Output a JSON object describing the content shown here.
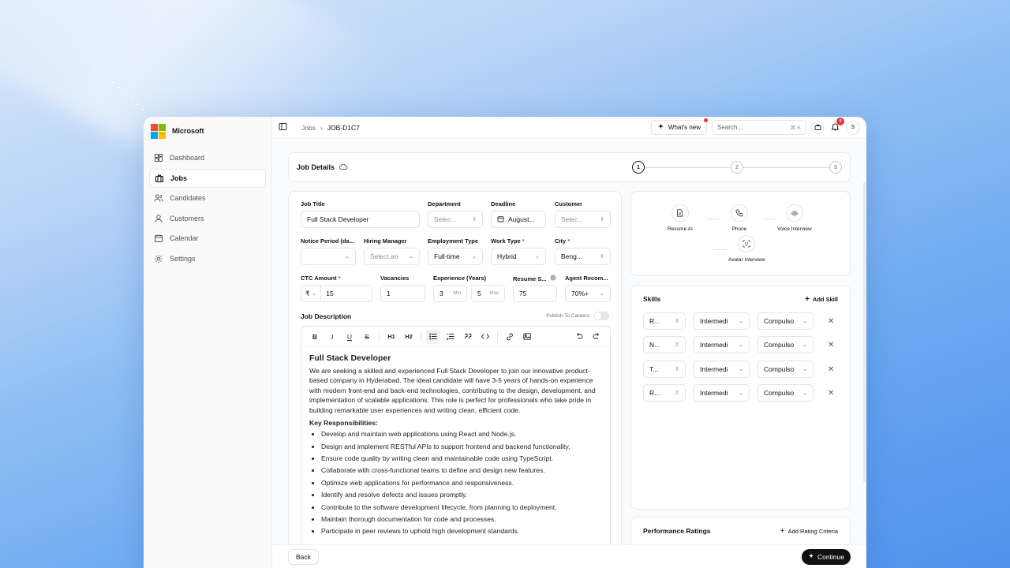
{
  "brand": {
    "name": "Microsoft",
    "logo_colors": [
      "#f25022",
      "#7fba00",
      "#00a4ef",
      "#ffb900"
    ]
  },
  "sidebar": {
    "items": [
      {
        "label": "Dashboard",
        "icon": "dashboard-icon",
        "active": false
      },
      {
        "label": "Jobs",
        "icon": "briefcase-icon",
        "active": true
      },
      {
        "label": "Candidates",
        "icon": "users-icon",
        "active": false
      },
      {
        "label": "Customers",
        "icon": "customers-icon",
        "active": false
      },
      {
        "label": "Calendar",
        "icon": "calendar-icon",
        "active": false
      },
      {
        "label": "Settings",
        "icon": "gear-icon",
        "active": false
      }
    ]
  },
  "topbar": {
    "breadcrumb": [
      "Jobs",
      "JOB-D1C7"
    ],
    "whats_new": "What's new",
    "search_placeholder": "Search...",
    "search_shortcut": "⌘ K",
    "notification_count": "4",
    "avatar_initial": "S"
  },
  "stepper": {
    "title": "Job Details",
    "steps": [
      "1",
      "2",
      "3"
    ],
    "active_step": 1
  },
  "form": {
    "job_title": {
      "label": "Job Title",
      "value": "Full Stack Developer"
    },
    "department": {
      "label": "Department",
      "value": "Selec..."
    },
    "deadline": {
      "label": "Deadline",
      "value": "August..."
    },
    "customer": {
      "label": "Customer",
      "value": "Selec..."
    },
    "notice_period": {
      "label": "Notice Period (da...",
      "value": ""
    },
    "hiring_manager": {
      "label": "Hiring Manager",
      "value": "Select an"
    },
    "employment_type": {
      "label": "Employment Type",
      "value": "Full-time"
    },
    "work_type": {
      "label": "Work Type",
      "value": "Hybrid",
      "required": "*"
    },
    "city": {
      "label": "City",
      "value": "Beng...",
      "required": "*"
    },
    "ctc_amount": {
      "label": "CTC Amount",
      "currency": "₹",
      "value": "15",
      "required": "*"
    },
    "vacancies": {
      "label": "Vacancies",
      "value": "1"
    },
    "experience": {
      "label": "Experience (Years)",
      "min": "3",
      "min_label": "Min",
      "max": "5",
      "max_label": "Max"
    },
    "resume_score": {
      "label": "Resume S...",
      "value": "75"
    },
    "agent_recommend": {
      "label": "Agent Recom...",
      "value": "70%+"
    },
    "job_description_label": "Job Description",
    "publish_label": "Publish To Careers",
    "publish_on": false
  },
  "editor": {
    "toolbar": [
      "B",
      "I",
      "U",
      "S",
      "H1",
      "H2",
      "bullet-list",
      "ordered-list",
      "quote",
      "code",
      "link",
      "image",
      "undo",
      "redo"
    ],
    "heading": "Full Stack Developer",
    "intro": "We are seeking a skilled and experienced Full Stack Developer to join our innovative product-based company in Hyderabad. The ideal candidate will have 3-5 years of hands-on experience with modern front-end and back-end technologies, contributing to the design, development, and implementation of scalable applications. This role is perfect for professionals who take pride in building remarkable user experiences and writing clean, efficient code.",
    "responsibilities_title": "Key Responsibilities:",
    "responsibilities": [
      "Develop and maintain web applications using React and Node.js.",
      "Design and implement RESTful APIs to support frontend and backend functionality.",
      "Ensure code quality by writing clean and maintainable code using TypeScript.",
      "Collaborate with cross-functional teams to define and design new features.",
      "Optimize web applications for performance and responsiveness.",
      "Identify and resolve defects and issues promptly.",
      "Contribute to the software development lifecycle, from planning to deployment.",
      "Maintain thorough documentation for code and processes.",
      "Participate in peer reviews to uphold high development standards."
    ]
  },
  "interview_rounds": [
    {
      "label": "Resume AI",
      "icon": "document-icon"
    },
    {
      "label": "Phone",
      "icon": "phone-icon"
    },
    {
      "label": "Voice Interview",
      "icon": "waveform-icon"
    },
    {
      "label": "Avatar Interview",
      "icon": "face-scan-icon"
    }
  ],
  "skills": {
    "title": "Skills",
    "add_label": "Add Skill",
    "rows": [
      {
        "skill": "R...",
        "level": "Intermedi",
        "requirement": "Compulso"
      },
      {
        "skill": "N...",
        "level": "Intermedi",
        "requirement": "Compulso"
      },
      {
        "skill": "T...",
        "level": "Intermedi",
        "requirement": "Compulso"
      },
      {
        "skill": "R...",
        "level": "Intermedi",
        "requirement": "Compulso"
      }
    ]
  },
  "performance": {
    "title": "Performance Ratings",
    "add_label": "Add Rating Criteria"
  },
  "footer": {
    "back": "Back",
    "continue": "Continue"
  }
}
